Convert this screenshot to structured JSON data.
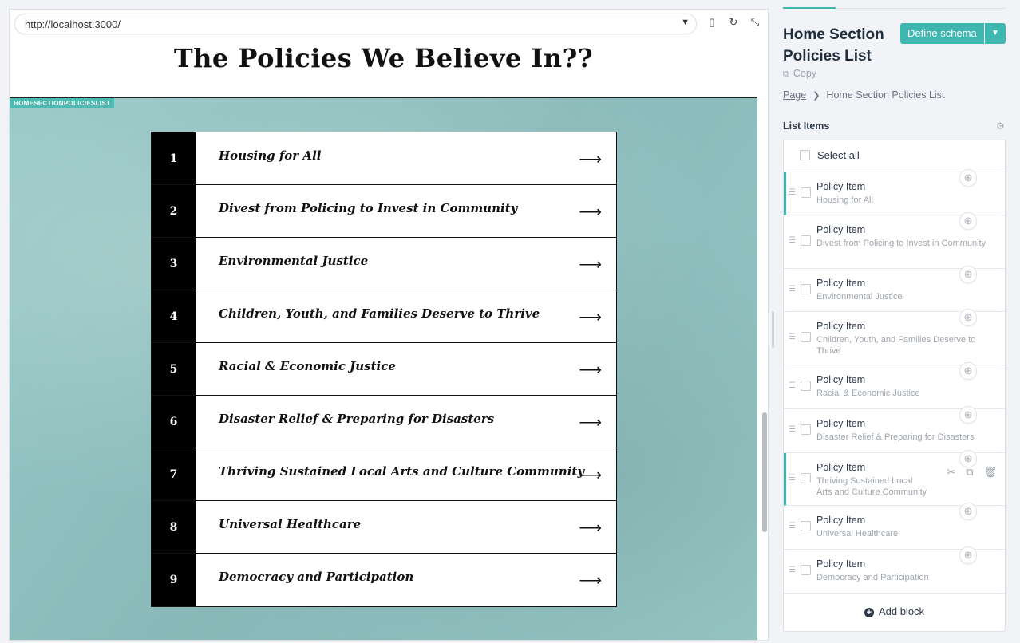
{
  "browser": {
    "url": "http://localhost:3000/"
  },
  "site": {
    "title": "The Policies We Believe In??",
    "section_tag": "HOMESECTIONPOLICIESLIST",
    "policies": [
      {
        "num": "1",
        "name": "Housing for All"
      },
      {
        "num": "2",
        "name": "Divest from Policing to Invest in Community"
      },
      {
        "num": "3",
        "name": "Environmental Justice"
      },
      {
        "num": "4",
        "name": "Children, Youth, and Families Deserve to Thrive"
      },
      {
        "num": "5",
        "name": "Racial & Economic Justice"
      },
      {
        "num": "6",
        "name": "Disaster Relief & Preparing for Disasters"
      },
      {
        "num": "7",
        "name": "Thriving Sustained Local Arts and Culture Community"
      },
      {
        "num": "8",
        "name": "Universal Healthcare"
      },
      {
        "num": "9",
        "name": "Democracy and Participation"
      }
    ],
    "arrow": "⟶"
  },
  "sidebar": {
    "title": "Home Section Policies List",
    "define_schema": "Define schema",
    "copy": "Copy",
    "breadcrumb": {
      "root": "Page",
      "current": "Home Section Policies List"
    },
    "list_label": "List Items",
    "select_all": "Select all",
    "items": [
      {
        "title": "Policy Item",
        "subtitle": "Housing for All"
      },
      {
        "title": "Policy Item",
        "subtitle": "Divest from Policing to Invest in Community"
      },
      {
        "title": "Policy Item",
        "subtitle": "Environmental Justice"
      },
      {
        "title": "Policy Item",
        "subtitle": "Children, Youth, and Families Deserve to Thrive"
      },
      {
        "title": "Policy Item",
        "subtitle": "Racial & Economic Justice"
      },
      {
        "title": "Policy Item",
        "subtitle": "Disaster Relief & Preparing for Disasters"
      },
      {
        "title": "Policy Item",
        "subtitle": "Thriving Sustained Local Arts and Culture Community"
      },
      {
        "title": "Policy Item",
        "subtitle": "Universal Healthcare"
      },
      {
        "title": "Policy Item",
        "subtitle": "Democracy and Participation"
      }
    ],
    "add_block": "Add block"
  },
  "icons": {
    "url_dropdown": "chevron-down-icon",
    "device": "mobile-device-icon",
    "reload": "reload-icon",
    "collapse": "collapse-icon",
    "copy": "copy-icon",
    "settings": "gear-icon",
    "drag": "drag-handle-icon",
    "add": "plus-circle-icon",
    "cut": "scissors-icon",
    "duplicate": "duplicate-icon",
    "delete": "trash-icon"
  },
  "colors": {
    "accent": "#3fb6b0",
    "section_bg": "#8fc3c2",
    "number_bg": "#000000"
  }
}
